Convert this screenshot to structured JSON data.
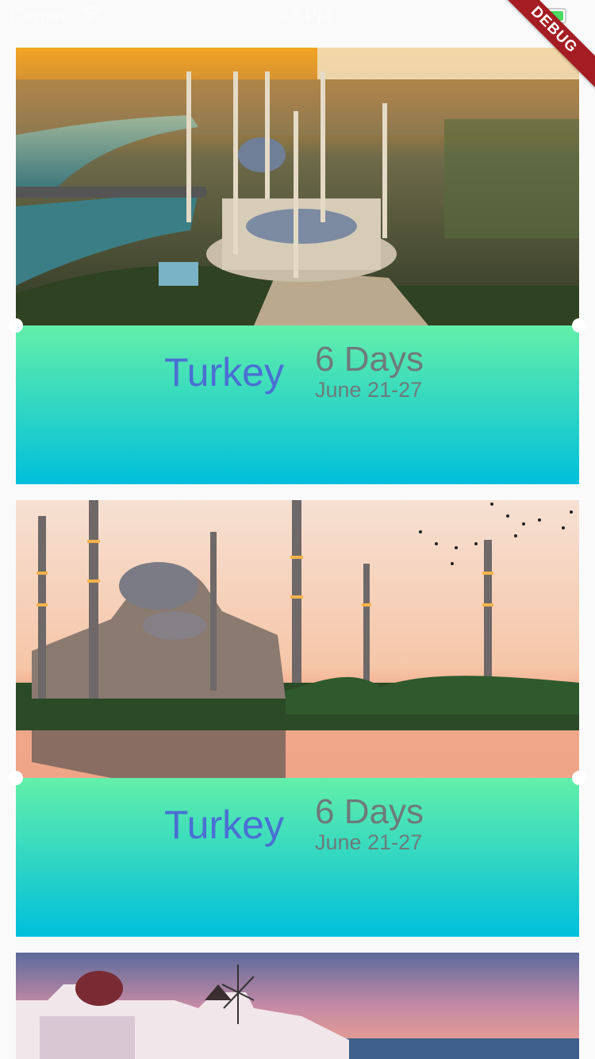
{
  "status_bar": {
    "carrier": "Carrier",
    "time": "8:47 PM"
  },
  "debug_banner": "DEBUG",
  "trips": [
    {
      "destination": "Turkey",
      "duration": "6 Days",
      "dates": "June 21-27",
      "image": "aerial-mosque-photo"
    },
    {
      "destination": "Turkey",
      "duration": "6 Days",
      "dates": "June 21-27",
      "image": "blue-mosque-sunset-photo"
    }
  ],
  "colors": {
    "gradient_top": "#63efa9",
    "gradient_bottom": "#00bfdb",
    "destination_text": "#4a6fd3",
    "detail_text": "#6e7a7a",
    "debug": "#a41d23"
  }
}
